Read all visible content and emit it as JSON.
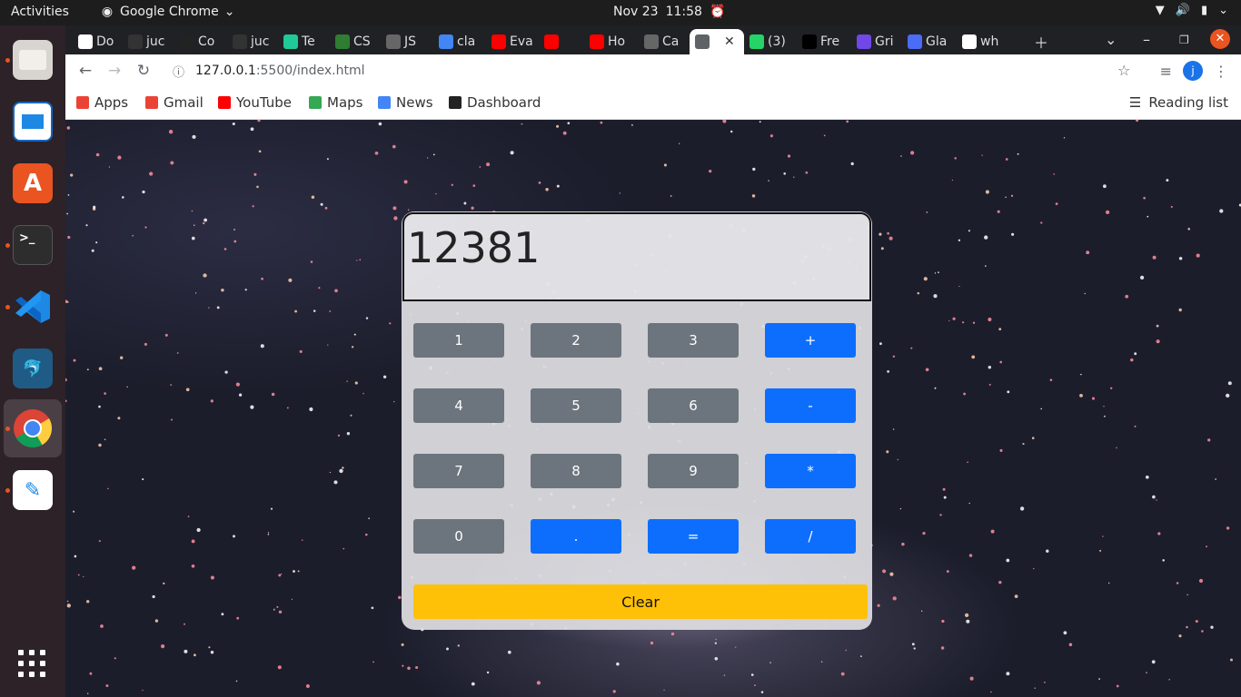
{
  "topbar": {
    "activities": "Activities",
    "app_name": "Google Chrome",
    "date": "Nov 23",
    "time": "11:58"
  },
  "dock": {
    "items": [
      "files-icon",
      "libreoffice-impress-icon",
      "software-center-icon",
      "terminal-icon",
      "vscode-icon",
      "mysql-workbench-icon",
      "chrome-icon",
      "text-editor-icon"
    ],
    "show_apps": "show-applications-icon"
  },
  "tabs": [
    {
      "label": "Do",
      "color": "#ffffff",
      "fg": "#111"
    },
    {
      "label": "juc",
      "color": "#333333",
      "fg": "#fff"
    },
    {
      "label": "Co",
      "color": "#222222",
      "fg": "#e8c800"
    },
    {
      "label": "juc",
      "color": "#333333",
      "fg": "#fff"
    },
    {
      "label": "Te",
      "color": "#20c997",
      "fg": "#fff"
    },
    {
      "label": "CS",
      "color": "#2e7d32",
      "fg": "#fff"
    },
    {
      "label": "JS",
      "color": "#666666",
      "fg": "#fff"
    },
    {
      "label": "cla",
      "color": "#4285f4",
      "fg": "#fff"
    },
    {
      "label": "Eva",
      "color": "#ff0000",
      "fg": "#fff"
    },
    {
      "label": "",
      "color": "#ff0000",
      "fg": "#fff"
    },
    {
      "label": "Ho",
      "color": "#ff0000",
      "fg": "#fff"
    },
    {
      "label": "Ca",
      "color": "#666666",
      "fg": "#fff"
    },
    {
      "label": "",
      "color": "#5f6368",
      "fg": "#fff"
    },
    {
      "label": "(3)",
      "color": "#25d366",
      "fg": "#fff"
    },
    {
      "label": "Fre",
      "color": "#000000",
      "fg": "#fff"
    },
    {
      "label": "Gri",
      "color": "#7048e8",
      "fg": "#fff"
    },
    {
      "label": "Gla",
      "color": "#4a6cf7",
      "fg": "#fff"
    },
    {
      "label": "wh",
      "color": "#ffffff",
      "fg": "#4285f4"
    }
  ],
  "address": {
    "host": "127.0.0.1",
    "path": ":5500/index.html"
  },
  "profile_initial": "j",
  "bookmarks": [
    {
      "label": "Apps",
      "color": "#ea4335"
    },
    {
      "label": "Gmail",
      "color": "#ea4335"
    },
    {
      "label": "YouTube",
      "color": "#ff0000"
    },
    {
      "label": "Maps",
      "color": "#34a853"
    },
    {
      "label": "News",
      "color": "#4285f4"
    },
    {
      "label": "Dashboard",
      "color": "#222222"
    }
  ],
  "reading_list": "Reading list",
  "calculator": {
    "display": "12381",
    "keys": [
      {
        "label": "1",
        "style": "gray"
      },
      {
        "label": "2",
        "style": "gray"
      },
      {
        "label": "3",
        "style": "gray"
      },
      {
        "label": "+",
        "style": "blue"
      },
      {
        "label": "4",
        "style": "gray"
      },
      {
        "label": "5",
        "style": "gray"
      },
      {
        "label": "6",
        "style": "gray"
      },
      {
        "label": "-",
        "style": "blue"
      },
      {
        "label": "7",
        "style": "gray"
      },
      {
        "label": "8",
        "style": "gray"
      },
      {
        "label": "9",
        "style": "gray"
      },
      {
        "label": "*",
        "style": "blue"
      },
      {
        "label": "0",
        "style": "gray"
      },
      {
        "label": ".",
        "style": "blue"
      },
      {
        "label": "=",
        "style": "blue"
      },
      {
        "label": "/",
        "style": "blue"
      }
    ],
    "clear": "Clear"
  }
}
